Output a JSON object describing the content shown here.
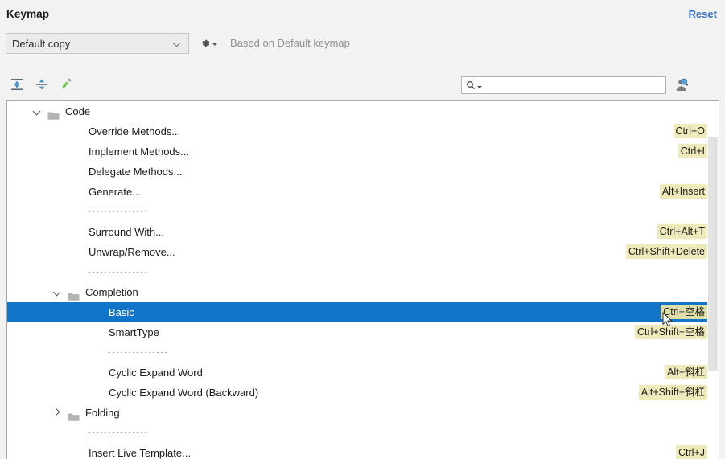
{
  "header": {
    "title": "Keymap",
    "reset_label": "Reset"
  },
  "selector": {
    "keymap_value": "Default copy",
    "gear_icon": "gear-icon",
    "based_on_text": "Based on Default keymap"
  },
  "toolbar": {
    "icons": [
      {
        "name": "expand-all-icon",
        "tooltip": "Expand All"
      },
      {
        "name": "collapse-all-icon",
        "tooltip": "Collapse All"
      },
      {
        "name": "edit-pencil-icon",
        "tooltip": "Edit Shortcut"
      }
    ]
  },
  "search": {
    "icon": "search-icon",
    "value": "",
    "placeholder": "",
    "find_by_shortcut_icon": "find-by-shortcut-icon"
  },
  "tree": {
    "rows": [
      {
        "kind": "folder",
        "label": "Code",
        "depth": 0,
        "expanded": true,
        "shortcut": ""
      },
      {
        "kind": "item",
        "label": "Override Methods...",
        "depth": 2,
        "shortcut": "Ctrl+O"
      },
      {
        "kind": "item",
        "label": "Implement Methods...",
        "depth": 2,
        "shortcut": "Ctrl+I"
      },
      {
        "kind": "item",
        "label": "Delegate Methods...",
        "depth": 2,
        "shortcut": ""
      },
      {
        "kind": "item",
        "label": "Generate...",
        "depth": 2,
        "shortcut": "Alt+Insert"
      },
      {
        "kind": "separator",
        "label": "",
        "depth": 2,
        "shortcut": ""
      },
      {
        "kind": "item",
        "label": "Surround With...",
        "depth": 2,
        "shortcut": "Ctrl+Alt+T"
      },
      {
        "kind": "item",
        "label": "Unwrap/Remove...",
        "depth": 2,
        "shortcut": "Ctrl+Shift+Delete"
      },
      {
        "kind": "separator",
        "label": "",
        "depth": 2,
        "shortcut": ""
      },
      {
        "kind": "folder",
        "label": "Completion",
        "depth": 1,
        "expanded": true,
        "shortcut": ""
      },
      {
        "kind": "item",
        "label": "Basic",
        "depth": 3,
        "shortcut": "Ctrl+空格",
        "selected": true
      },
      {
        "kind": "item",
        "label": "SmartType",
        "depth": 3,
        "shortcut": "Ctrl+Shift+空格"
      },
      {
        "kind": "separator",
        "label": "",
        "depth": 3,
        "shortcut": ""
      },
      {
        "kind": "item",
        "label": "Cyclic Expand Word",
        "depth": 3,
        "shortcut": "Alt+斜杠"
      },
      {
        "kind": "item",
        "label": "Cyclic Expand Word (Backward)",
        "depth": 3,
        "shortcut": "Alt+Shift+斜杠"
      },
      {
        "kind": "folder",
        "label": "Folding",
        "depth": 1,
        "expanded": false,
        "shortcut": ""
      },
      {
        "kind": "separator",
        "label": "",
        "depth": 2,
        "shortcut": ""
      },
      {
        "kind": "item",
        "label": "Insert Live Template...",
        "depth": 2,
        "shortcut": "Ctrl+J"
      }
    ]
  },
  "colors": {
    "selection_blue": "#1274c8",
    "shortcut_highlight": "#efeaba",
    "link_blue": "#3a72c4",
    "panel_background": "#f2f2f2"
  }
}
